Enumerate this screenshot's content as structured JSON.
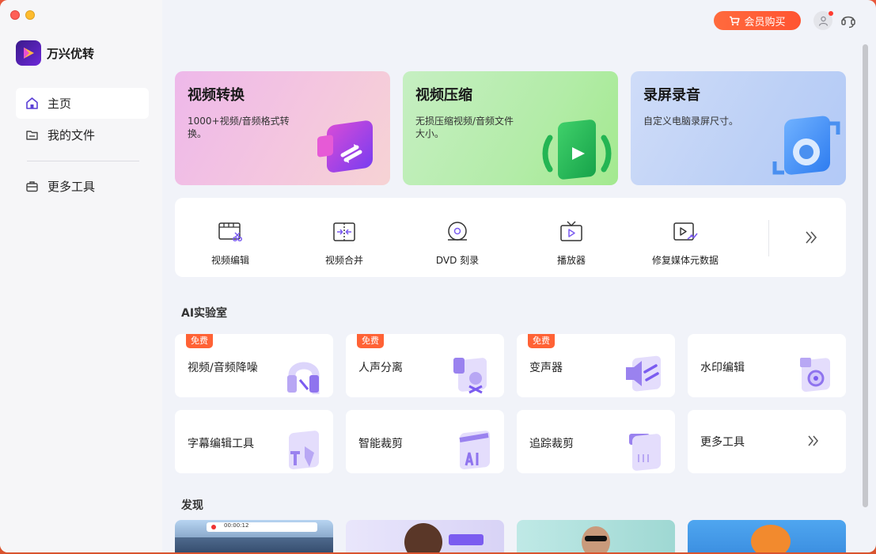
{
  "app": {
    "name": "万兴优转"
  },
  "sidebar": {
    "items": [
      {
        "label": "主页"
      },
      {
        "label": "我的文件"
      },
      {
        "label": "更多工具"
      }
    ]
  },
  "topbar": {
    "purchase_label": "会员购买"
  },
  "hero": [
    {
      "title": "视频转换",
      "desc": "1000+视频/音频格式转换。"
    },
    {
      "title": "视频压缩",
      "desc": "无损压缩视频/音频文件大小。"
    },
    {
      "title": "录屏录音",
      "desc": "自定义电脑录屏尺寸。"
    }
  ],
  "tools": [
    {
      "label": "视频编辑",
      "icon": "video-edit-icon"
    },
    {
      "label": "视频合并",
      "icon": "video-merge-icon"
    },
    {
      "label": "DVD 刻录",
      "icon": "dvd-icon"
    },
    {
      "label": "播放器",
      "icon": "player-icon"
    },
    {
      "label": "修复媒体元数据",
      "icon": "metadata-fix-icon"
    }
  ],
  "ai_lab": {
    "title": "AI实验室",
    "free_badge": "免费",
    "cards": [
      {
        "label": "视频/音频降噪",
        "free": true
      },
      {
        "label": "人声分离",
        "free": true
      },
      {
        "label": "变声器",
        "free": true
      },
      {
        "label": "水印编辑",
        "free": false
      },
      {
        "label": "字幕编辑工具",
        "free": false
      },
      {
        "label": "智能裁剪",
        "free": false
      },
      {
        "label": "追踪裁剪",
        "free": false
      },
      {
        "label": "更多工具",
        "free": false
      }
    ]
  },
  "discover": {
    "title": "发现",
    "player_time": "00:00:12"
  },
  "colors": {
    "accent": "#ff5a34",
    "purple": "#7b5cf0"
  }
}
